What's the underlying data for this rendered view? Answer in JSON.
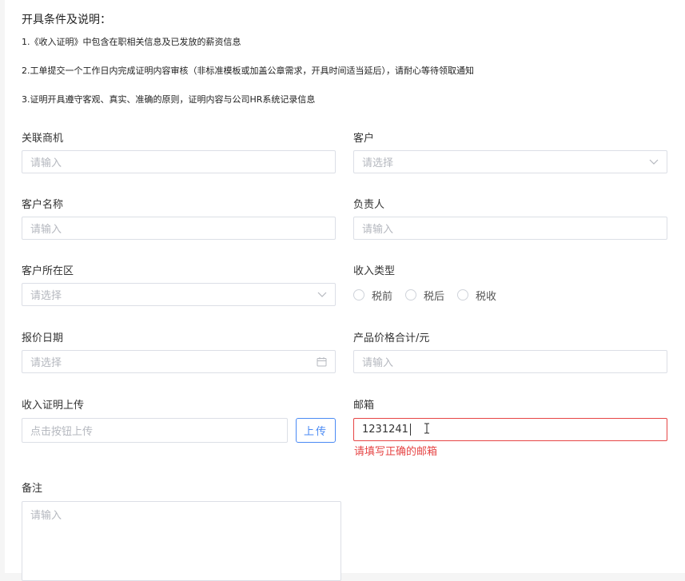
{
  "notice": {
    "title": "开具条件及说明：",
    "items": [
      "1.《收入证明》中包含在职相关信息及已发放的薪资信息",
      "2.工单提交一个工作日内完成证明内容审核（非标准模板或加盖公章需求，开具时间适当延后），请耐心等待领取通知",
      "3.证明开具遵守客观、真实、准确的原则，证明内容与公司HR系统记录信息"
    ]
  },
  "form": {
    "related_opportunity": {
      "label": "关联商机",
      "placeholder": "请输入"
    },
    "customer": {
      "label": "客户",
      "placeholder": "请选择",
      "icon": "chevron-down-icon"
    },
    "customer_name": {
      "label": "客户名称",
      "placeholder": "请输入"
    },
    "owner": {
      "label": "负责人",
      "placeholder": "请输入"
    },
    "customer_region": {
      "label": "客户所在区",
      "placeholder": "请选择",
      "icon": "chevron-down-icon"
    },
    "income_type": {
      "label": "收入类型",
      "options": [
        "税前",
        "税后",
        "税收"
      ]
    },
    "quote_date": {
      "label": "报价日期",
      "placeholder": "请选择",
      "icon": "calendar-icon"
    },
    "product_total": {
      "label": "产品价格合计/元",
      "placeholder": "请输入"
    },
    "income_proof_upload": {
      "label": "收入证明上传",
      "placeholder": "点击按钮上传",
      "button": "上传"
    },
    "email": {
      "label": "邮箱",
      "value": "1231241",
      "error": "请填写正确的邮箱"
    },
    "remark": {
      "label": "备注",
      "placeholder": "请输入"
    }
  },
  "colors": {
    "error": "#e64545",
    "primary": "#4a8af4",
    "border": "#dcdfe6",
    "placeholder": "#b5b8bf"
  }
}
